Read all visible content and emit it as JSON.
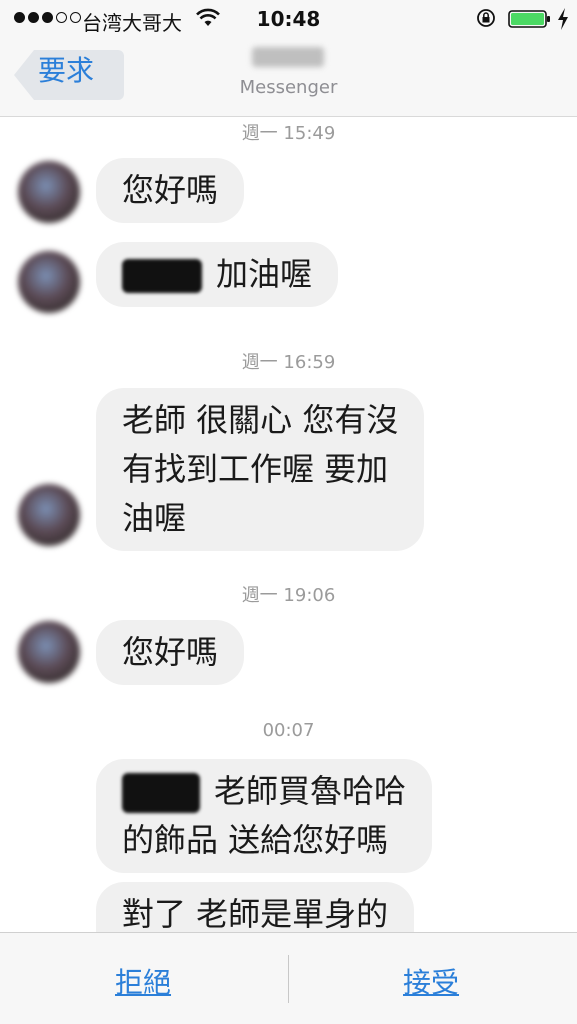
{
  "status_bar": {
    "carrier": "台湾大哥大",
    "time": "10:48",
    "signal_bars_filled": 3,
    "signal_bars_total": 5,
    "battery_color": "#4cd964"
  },
  "nav": {
    "back_label": "要求",
    "subtitle": "Messenger"
  },
  "messages": {
    "ts1": "週一 15:49",
    "m1": "您好嗎",
    "m2_text": "加油喔",
    "ts2": "週一 16:59",
    "m3_line1": "老師  很關心  您有沒",
    "m3_line2": "有找到工作喔   要加",
    "m3_line3": "油喔",
    "ts3": "週一 19:06",
    "m4": "您好嗎",
    "ts4": "00:07",
    "m5_line1": "老師買魯哈哈",
    "m5_line2": "的飾品 送給您好嗎",
    "m6_line1": "對了  老師是單身的"
  },
  "actions": {
    "decline": "拒絕",
    "accept": "接受"
  },
  "colors": {
    "accent": "#2b7fd9",
    "bubble": "#f0f0f0",
    "timestamp": "#9b9b9b"
  }
}
